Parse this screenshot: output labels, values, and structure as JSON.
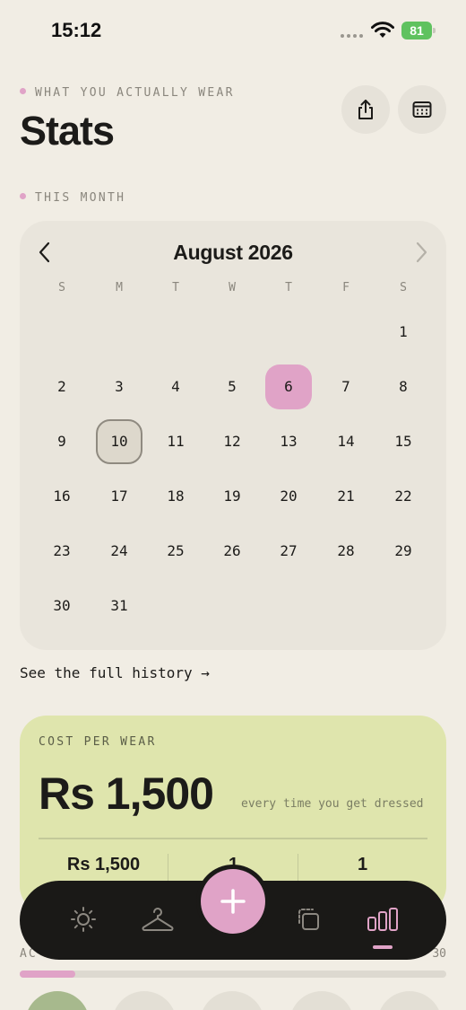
{
  "status": {
    "time": "15:12",
    "battery": "81"
  },
  "header": {
    "eyebrow": "WHAT YOU ACTUALLY WEAR",
    "title": "Stats"
  },
  "section": {
    "this_month": "THIS MONTH"
  },
  "calendar": {
    "month": "August 2026",
    "weekdays": [
      "S",
      "M",
      "T",
      "W",
      "T",
      "F",
      "S"
    ],
    "weeks": [
      [
        "",
        "",
        "",
        "",
        "",
        "",
        "1"
      ],
      [
        "2",
        "3",
        "4",
        "5",
        "6",
        "7",
        "8"
      ],
      [
        "9",
        "10",
        "11",
        "12",
        "13",
        "14",
        "15"
      ],
      [
        "16",
        "17",
        "18",
        "19",
        "20",
        "21",
        "22"
      ],
      [
        "23",
        "24",
        "25",
        "26",
        "27",
        "28",
        "29"
      ],
      [
        "30",
        "31",
        "",
        "",
        "",
        "",
        ""
      ]
    ],
    "selected_day": "6",
    "today": "10"
  },
  "history_link": "See the full history →",
  "cost_per_wear": {
    "label": "COST PER WEAR",
    "value": "Rs 1,500",
    "subtitle": "every time you get dressed",
    "stats": [
      "Rs 1,500",
      "1",
      "1"
    ]
  },
  "activity": {
    "label": "AC",
    "right": "30",
    "progress": 0.13
  },
  "colors": {
    "accent_pink": "#e0a3c7",
    "card_green": "#dfe5ad",
    "nav_dark": "#1a1917"
  },
  "nav": {
    "items": [
      "sun-icon",
      "hanger-icon",
      "add-icon",
      "copy-icon",
      "stats-bars-icon"
    ],
    "active": "stats-bars-icon"
  }
}
